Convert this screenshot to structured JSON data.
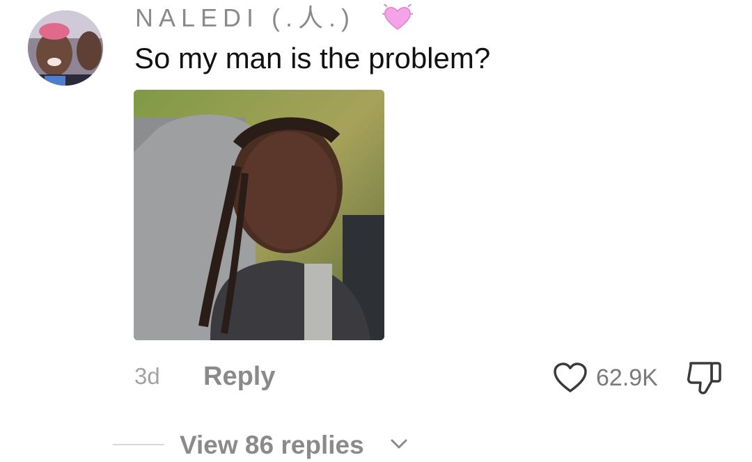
{
  "comment": {
    "username": "NALEDI (.人.)",
    "text": "So my man is the problem?",
    "timestamp": "3d",
    "reply_label": "Reply",
    "like_count": "62.9K",
    "view_replies_label": "View 86 replies"
  },
  "icons": {
    "username_emoji": "pink-heart-icon",
    "like": "heart-outline-icon",
    "dislike": "thumbs-down-icon",
    "expand": "chevron-down-icon"
  },
  "colors": {
    "username": "#8a8a8a",
    "text": "#111111",
    "muted": "#a3a3a3",
    "emoji_pink": "#f4a3e6"
  }
}
